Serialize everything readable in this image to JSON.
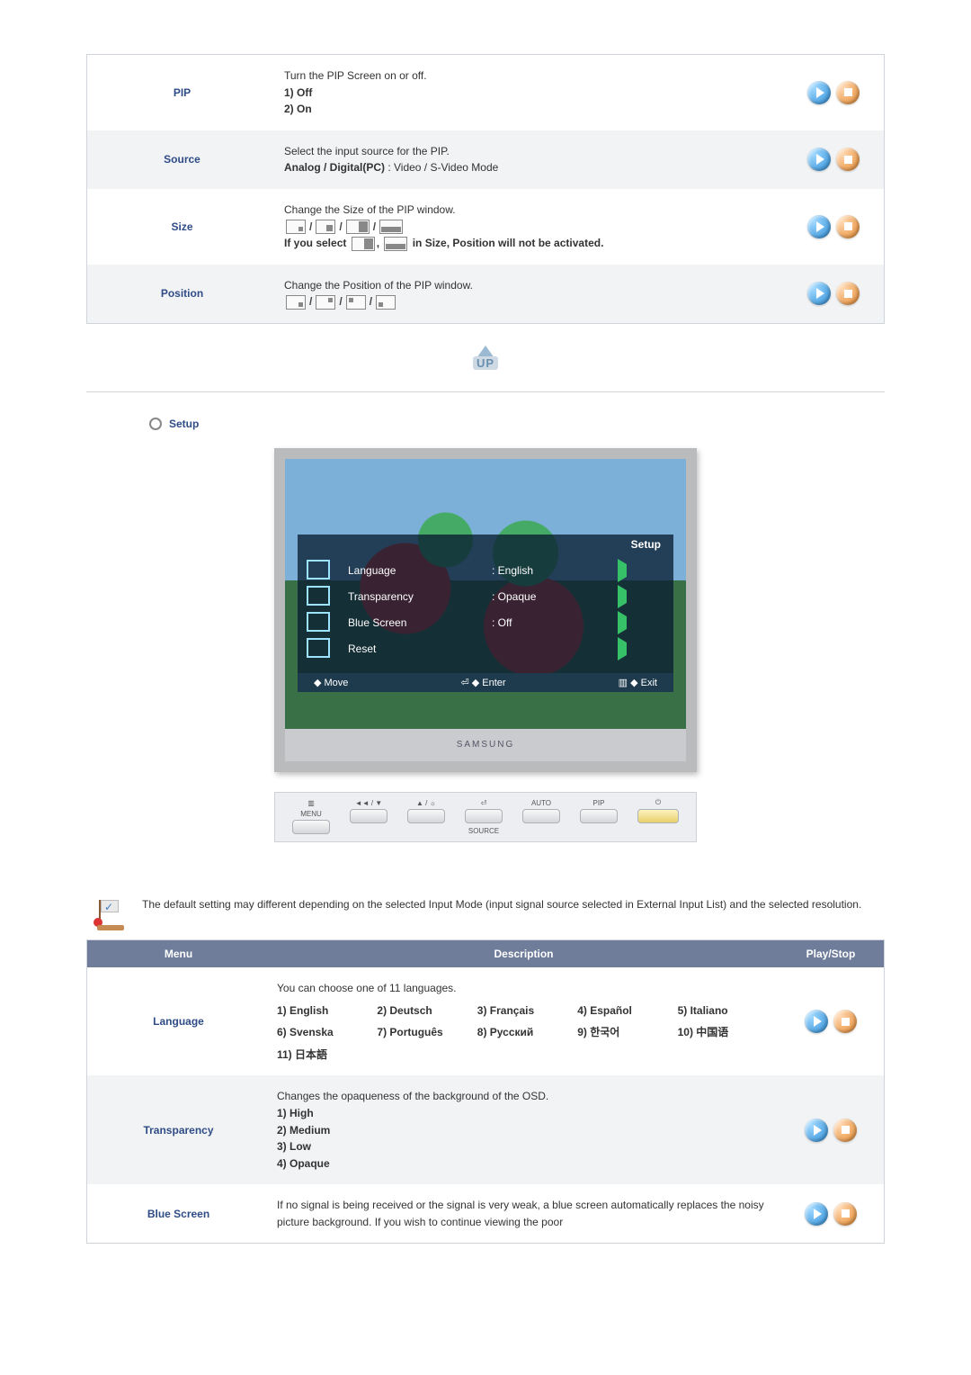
{
  "pip_rows": [
    {
      "name": "PIP",
      "type": "options",
      "intro": "Turn the PIP Screen on or off.",
      "options": [
        "1) Off",
        "2) On"
      ]
    },
    {
      "name": "Source",
      "type": "source",
      "line1": "Select the input source for the PIP.",
      "line2_label": "Analog / Digital(PC)",
      "line2_rest": " : Video / S-Video Mode"
    },
    {
      "name": "Size",
      "type": "size",
      "intro": "Change the Size of the PIP window.",
      "note_pre": "If you select ",
      "note_post": " in Size, Position will not be activated."
    },
    {
      "name": "Position",
      "type": "position",
      "intro": "Change the Position of the PIP window."
    }
  ],
  "up_label": "UP",
  "setup_heading": "Setup",
  "osd": {
    "title": "Setup",
    "items": [
      {
        "label": "Language",
        "value": ": English"
      },
      {
        "label": "Transparency",
        "value": ": Opaque"
      },
      {
        "label": "Blue Screen",
        "value": ": Off"
      },
      {
        "label": "Reset",
        "value": ""
      }
    ],
    "footer": {
      "move": "Move",
      "enter": "Enter",
      "exit": "Exit"
    },
    "brand": "SAMSUNG",
    "hw_buttons": {
      "menu": "MENU",
      "vol": "◄◄ / ▼",
      "bright": "▲ / ☼",
      "enter": "⏎",
      "auto": "AUTO",
      "pip": "PIP",
      "power": "⏻",
      "source": "SOURCE"
    }
  },
  "note_text": "The default setting may different depending on the selected Input Mode (input signal source selected in External Input List) and the selected resolution.",
  "setup_headers": {
    "menu": "Menu",
    "desc": "Description",
    "play": "Play/Stop"
  },
  "setup_rows": {
    "language": {
      "name": "Language",
      "intro": "You can choose one of 11 languages.",
      "list": [
        "1) English",
        "2) Deutsch",
        "3) Français",
        "4) Español",
        "5) Italiano",
        "6) Svenska",
        "7) Português",
        "8) Русский",
        "9) 한국어",
        "10) 中国语",
        "11) 日本語"
      ]
    },
    "transparency": {
      "name": "Transparency",
      "intro": "Changes the opaqueness of the background of the OSD.",
      "options": [
        "1) High",
        "2) Medium",
        "3) Low",
        "4) Opaque"
      ]
    },
    "bluescreen": {
      "name": "Blue Screen",
      "desc": "If no signal is being received or the signal is very weak, a blue screen automatically replaces the noisy picture background. If you wish to continue viewing the poor"
    }
  }
}
